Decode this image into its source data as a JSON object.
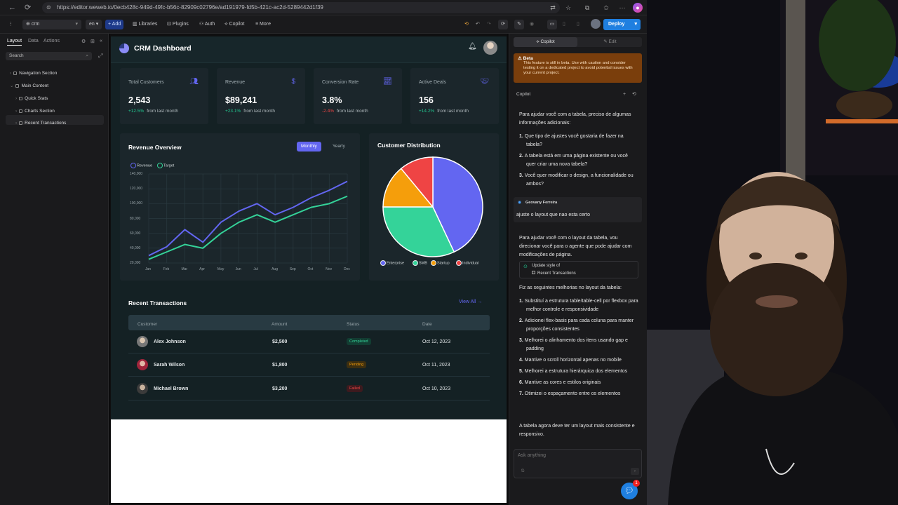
{
  "browser": {
    "url": "https://editor.weweb.io/0ecb428c-949d-49fc-b56c-82909c02796e/ad191979-fd5b-421c-ac2d-5289442d1f39"
  },
  "toolbar": {
    "project": "crm",
    "lang": "en",
    "add": "+ Add",
    "libraries": "Libraries",
    "plugins": "Plugins",
    "auth": "Auth",
    "copilot": "Copilot",
    "more": "More",
    "deploy": "Deploy"
  },
  "left_panel": {
    "tabs": [
      "Layout",
      "Data",
      "Actions"
    ],
    "search_placeholder": "Search",
    "tree": [
      "Navigation Section",
      "Main Content",
      "Quick Stats",
      "Charts Section",
      "Recent Transactions"
    ]
  },
  "app": {
    "title": "CRM Dashboard",
    "stats": [
      {
        "title": "Total Customers",
        "value": "2,543",
        "delta": "+12.5%",
        "from": "from last month",
        "icon": "users-icon"
      },
      {
        "title": "Revenue",
        "value": "$89,241",
        "delta": "+23.1%",
        "from": "from last month",
        "icon": "dollar-icon"
      },
      {
        "title": "Conversion Rate",
        "value": "3.8%",
        "delta": "-2.4%",
        "from": "from last month",
        "icon": "trend-icon"
      },
      {
        "title": "Active Deals",
        "value": "156",
        "delta": "+14.2%",
        "from": "from last month",
        "icon": "handshake-icon"
      }
    ],
    "revenue_overview": {
      "title": "Revenue Overview",
      "toggle": [
        "Monthly",
        "Yearly"
      ]
    },
    "customer_distribution": {
      "title": "Customer Distribution"
    },
    "transactions": {
      "title": "Recent Transactions",
      "view_all": "View All →",
      "headers": [
        "Customer",
        "Amount",
        "Status",
        "Date"
      ],
      "rows": [
        {
          "customer": "Alex Johnson",
          "amount": "$2,500",
          "status": "Completed",
          "date": "Oct 12, 2023"
        },
        {
          "customer": "Sarah Wilson",
          "amount": "$1,800",
          "status": "Pending",
          "date": "Oct 11, 2023"
        },
        {
          "customer": "Michael Brown",
          "amount": "$3,200",
          "status": "Failed",
          "date": "Oct 10, 2023"
        }
      ]
    }
  },
  "chart_data": [
    {
      "type": "line",
      "title": "Revenue Overview",
      "x": [
        "Jan",
        "Feb",
        "Mar",
        "Apr",
        "May",
        "Jun",
        "Jul",
        "Aug",
        "Sep",
        "Oct",
        "Nov",
        "Dec"
      ],
      "ylim": [
        20000,
        140000
      ],
      "yticks": [
        "140,000",
        "120,000",
        "100,000",
        "80,000",
        "60,000",
        "40,000",
        "20,000"
      ],
      "yvals": [
        140000,
        120000,
        100000,
        80000,
        60000,
        40000,
        20000
      ],
      "series": [
        {
          "name": "Revenue",
          "color": "#6366f1",
          "values": [
            30000,
            42000,
            65000,
            48000,
            75000,
            90000,
            100000,
            85000,
            95000,
            108000,
            118000,
            130000
          ]
        },
        {
          "name": "Target",
          "color": "#34d399",
          "values": [
            25000,
            35000,
            45000,
            40000,
            60000,
            75000,
            85000,
            75000,
            85000,
            95000,
            100000,
            110000
          ]
        }
      ],
      "grid": true,
      "legend": "top-left"
    },
    {
      "type": "pie",
      "title": "Customer Distribution",
      "slices": [
        {
          "name": "Enterprise",
          "value": 43,
          "color": "#6366f1"
        },
        {
          "name": "SMB",
          "value": 32,
          "color": "#34d399"
        },
        {
          "name": "Startup",
          "value": 14,
          "color": "#f59e0b"
        },
        {
          "name": "Individual",
          "value": 11,
          "color": "#ef4444"
        }
      ],
      "legend": "bottom"
    }
  ],
  "right_panel": {
    "tabs": [
      "Copilot",
      "Edit"
    ],
    "beta_title": "Beta",
    "beta_text": "This feature is still in beta. Use with caution and consider testing it on a dedicated project to avoid potential issues with your current project.",
    "section": "Copilot",
    "msg1_intro": "Para ajudar você com a tabela, preciso de algumas informações adicionais:",
    "msg1_list": [
      "Que tipo de ajustes você gostaria de fazer na tabela?",
      "A tabela está em uma página existente ou você quer criar uma nova tabela?",
      "Você quer modificar o design, a funcionalidade ou ambos?"
    ],
    "user_name": "Geovany Ferreira",
    "user_msg": "ajuste o layout que nao esta certo",
    "msg2": "Para ajudar você com o layout da tabela, vou direcionar você para o agente que pode ajudar com modificações de página.",
    "tool_title": "Update style of",
    "tool_target": "Recent Transactions",
    "msg3_intro": "Fiz as seguintes melhorias no layout da tabela:",
    "msg3_list": [
      "Substituí a estrutura table/table-cell por flexbox para melhor controle e responsividade",
      "Adicionei flex-basis para cada coluna para manter proporções consistentes",
      "Melhorei o alinhamento dos itens usando gap e padding",
      "Mantive o scroll horizontal apenas no mobile",
      "Melhorei a estrutura hierárquica dos elementos",
      "Mantive as cores e estilos originais",
      "Otimizei o espaçamento entre os elementos"
    ],
    "msg3_outro": "A tabela agora deve ter um layout mais consistente e responsivo.",
    "ask_placeholder": "Ask anything",
    "help_badge": "1"
  }
}
